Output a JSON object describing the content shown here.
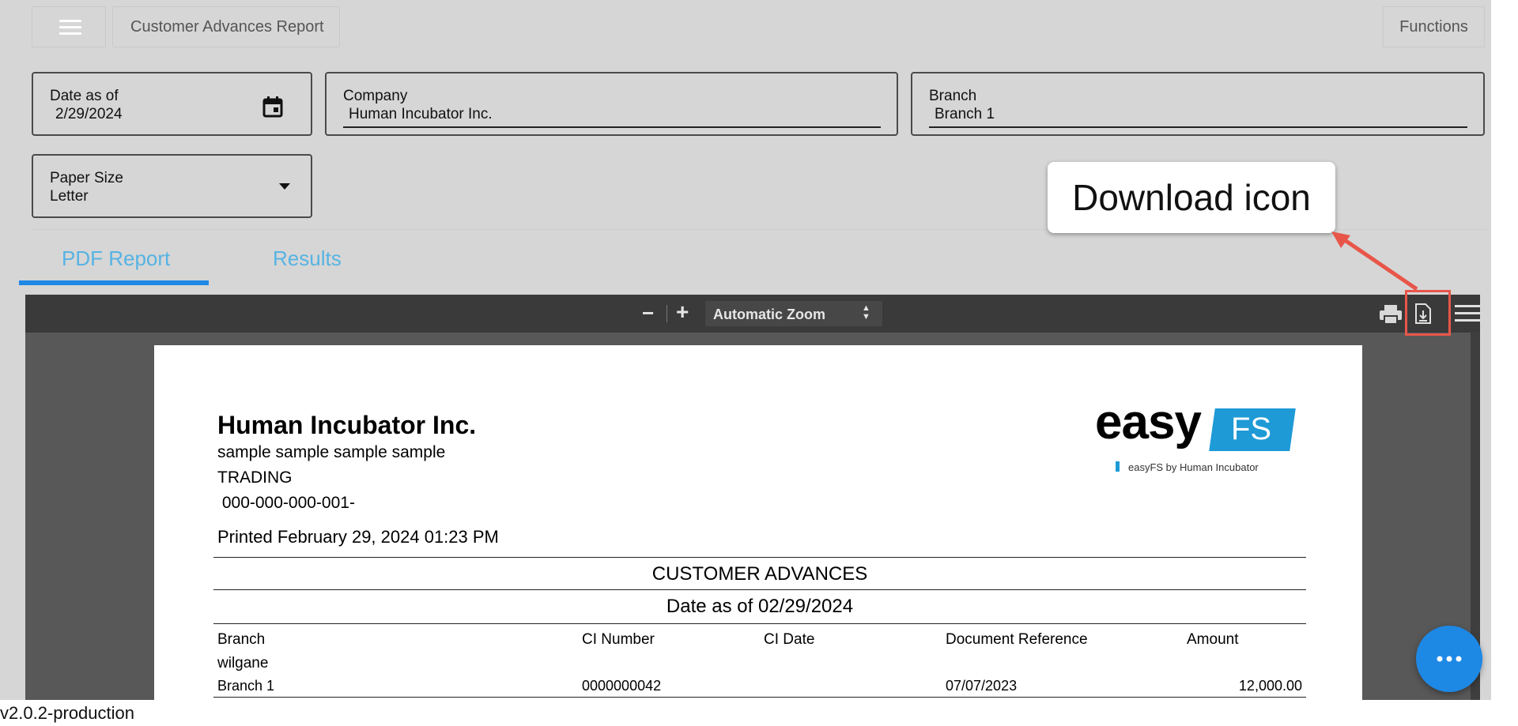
{
  "header": {
    "menu_icon": "hamburger-menu-icon",
    "title": "Customer Advances Report",
    "functions_label": "Functions"
  },
  "filters": {
    "date": {
      "label": "Date as of",
      "value": "2/29/2024",
      "icon": "calendar-icon"
    },
    "company": {
      "label": "Company",
      "value": "Human Incubator Inc."
    },
    "branch": {
      "label": "Branch",
      "value": "Branch 1"
    },
    "paper_size": {
      "label": "Paper Size",
      "value": "Letter",
      "icon": "dropdown-arrow-icon"
    }
  },
  "tabs": [
    {
      "label": "PDF Report",
      "active": true
    },
    {
      "label": "Results",
      "active": false
    }
  ],
  "viewer": {
    "zoom_out": "−",
    "zoom_in": "+",
    "zoom_label": "Automatic Zoom",
    "print_icon": "print-icon",
    "download_icon": "download-icon",
    "menu_icon": "tools-menu-icon"
  },
  "report": {
    "company_name": "Human Incubator Inc.",
    "line1": "sample sample sample sample",
    "line2": "TRADING",
    "line3": " 000-000-000-001-",
    "printed": "Printed February 29, 2024 01:23 PM",
    "logo_word": "easy",
    "logo_fs": "FS",
    "logo_tagline": "easyFS by Human Incubator",
    "title": "CUSTOMER ADVANCES",
    "date_line": "Date as of 02/29/2024",
    "columns": [
      "Branch",
      "CI Number",
      "CI Date",
      "Document Reference",
      "Amount"
    ],
    "group": "wilgane",
    "row": {
      "branch": "Branch 1",
      "ci_number": "0000000042",
      "ci_date": "",
      "doc_ref": "07/07/2023",
      "amount": "12,000.00"
    }
  },
  "annotation": {
    "callout_text": "Download icon",
    "color": "#e8564a"
  },
  "fab_icon": "more-options-icon",
  "version": "v2.0.2-production",
  "colors": {
    "accent": "#1e88e5",
    "tab_text": "#56b3e3",
    "logo_blue": "#1e9ad6"
  }
}
